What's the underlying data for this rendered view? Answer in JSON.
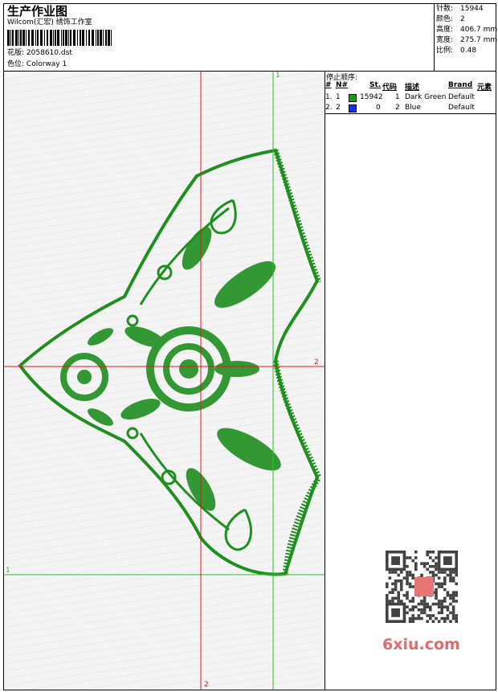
{
  "header": {
    "title": "生产作业图",
    "company": "Wilcom(汇宏) 绣饰工作室",
    "design_label": "花版:",
    "design_value": "2058610.dst",
    "colorway_label": "色位:",
    "colorway_value": "Colorway 1"
  },
  "stats": [
    {
      "label": "针数:",
      "value": "15944"
    },
    {
      "label": "颜色:",
      "value": "2"
    },
    {
      "label": "高度:",
      "value": "406.7 mm"
    },
    {
      "label": "宽度:",
      "value": "275.7 mm"
    },
    {
      "label": "比例:",
      "value": "0.48"
    }
  ],
  "stop_sequence": {
    "title": "停止顺序:",
    "headers": {
      "num": "#",
      "n": "N#",
      "st": "St.",
      "code": "代码",
      "desc": "描述",
      "brand": "Brand",
      "elem": "元素"
    },
    "rows": [
      {
        "num": "1.",
        "n": "1",
        "color": "#1a9a1a",
        "st": "15942",
        "code": "1",
        "desc": "Dark Green",
        "brand": "Default"
      },
      {
        "num": "2.",
        "n": "2",
        "color": "#1030ff",
        "st": "0",
        "code": "2",
        "desc": "Blue",
        "brand": "Default"
      }
    ]
  },
  "guides": {
    "label_top": "1",
    "label_right": "2",
    "label_left": "1",
    "label_bottom": "2"
  },
  "watermark": {
    "text": "6xiu.com"
  },
  "colors": {
    "embroidery": "#1f8f1f",
    "guide_green": "#22c422",
    "guide_red": "#e01818"
  }
}
